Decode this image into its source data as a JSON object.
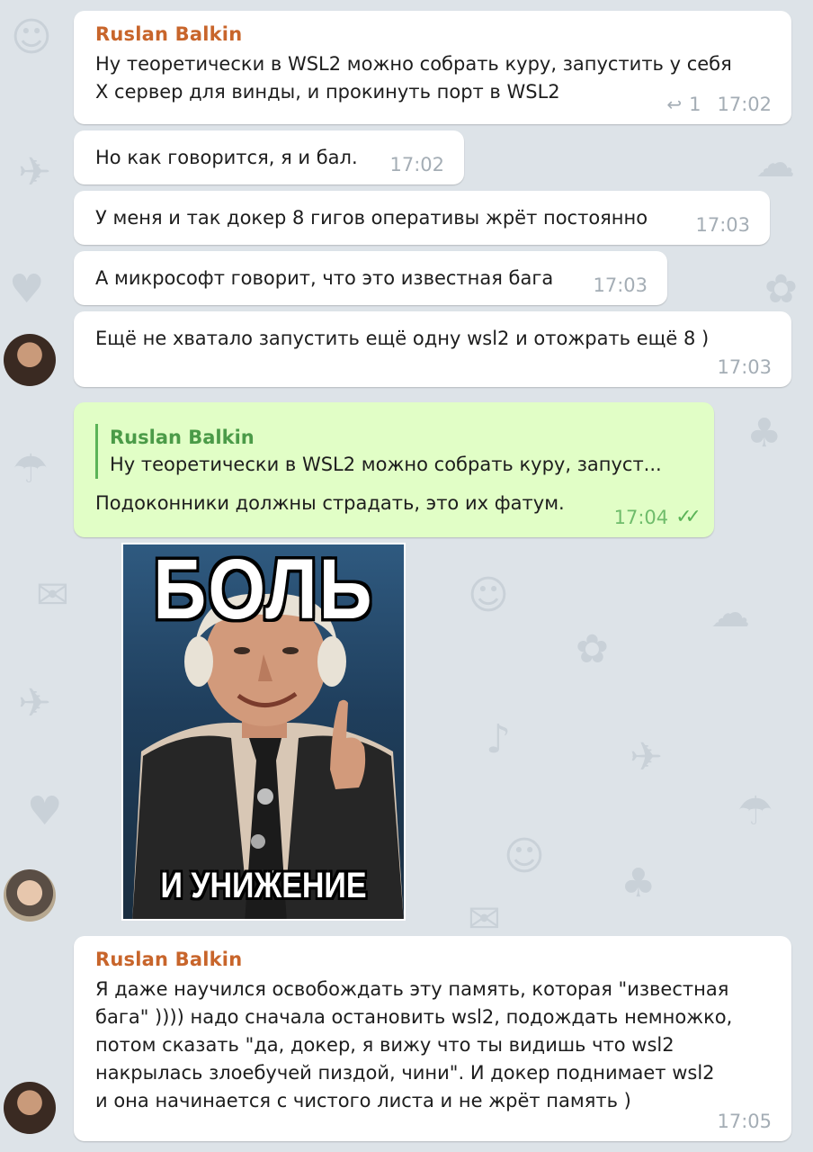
{
  "colors": {
    "background": "#dde3e8",
    "incoming_bubble": "#ffffff",
    "outgoing_bubble": "#e1fec6",
    "sender_name": "#c8652b",
    "reply_quote_accent": "#5bb457"
  },
  "messages": [
    {
      "sender": "Ruslan Balkin",
      "text": "Ну теоретически в WSL2 можно собрать куру, запустить у себя\nX сервер для винды, и прокинуть порт в WSL2",
      "reply_count": "1",
      "time": "17:02"
    },
    {
      "text": "Но как говорится, я и бал.",
      "time": "17:02"
    },
    {
      "text": "У меня и так докер 8 гигов оперативы жрёт постоянно",
      "time": "17:03"
    },
    {
      "text": "А микрософт говорит, что это известная бага",
      "time": "17:03"
    },
    {
      "text": "Ещё не хватало запустить ещё одну wsl2 и отожрать ещё 8 )",
      "time": "17:03"
    },
    {
      "outgoing": true,
      "reply_to": {
        "name": "Ruslan Balkin",
        "text": "Ну теоретически в WSL2 можно собрать куру, запуст..."
      },
      "text": "Подоконники должны страдать, это их фатум.",
      "time": "17:04",
      "status_icon": "double-check-icon"
    },
    {
      "type": "image",
      "meme_top": "БОЛЬ",
      "meme_bottom": "И УНИЖЕНИЕ"
    },
    {
      "sender": "Ruslan Balkin",
      "text": "Я даже научился освобождать эту память, которая \"известная\nбага\" )))) надо сначала остановить wsl2, подождать немножко,\nпотом сказать \"да, докер, я вижу что ты видишь что wsl2\nнакрылась злоебучей пиздой, чини\". И докер поднимает wsl2\nи она начинается с чистого листа и не жрёт память )",
      "time": "17:05"
    }
  ]
}
